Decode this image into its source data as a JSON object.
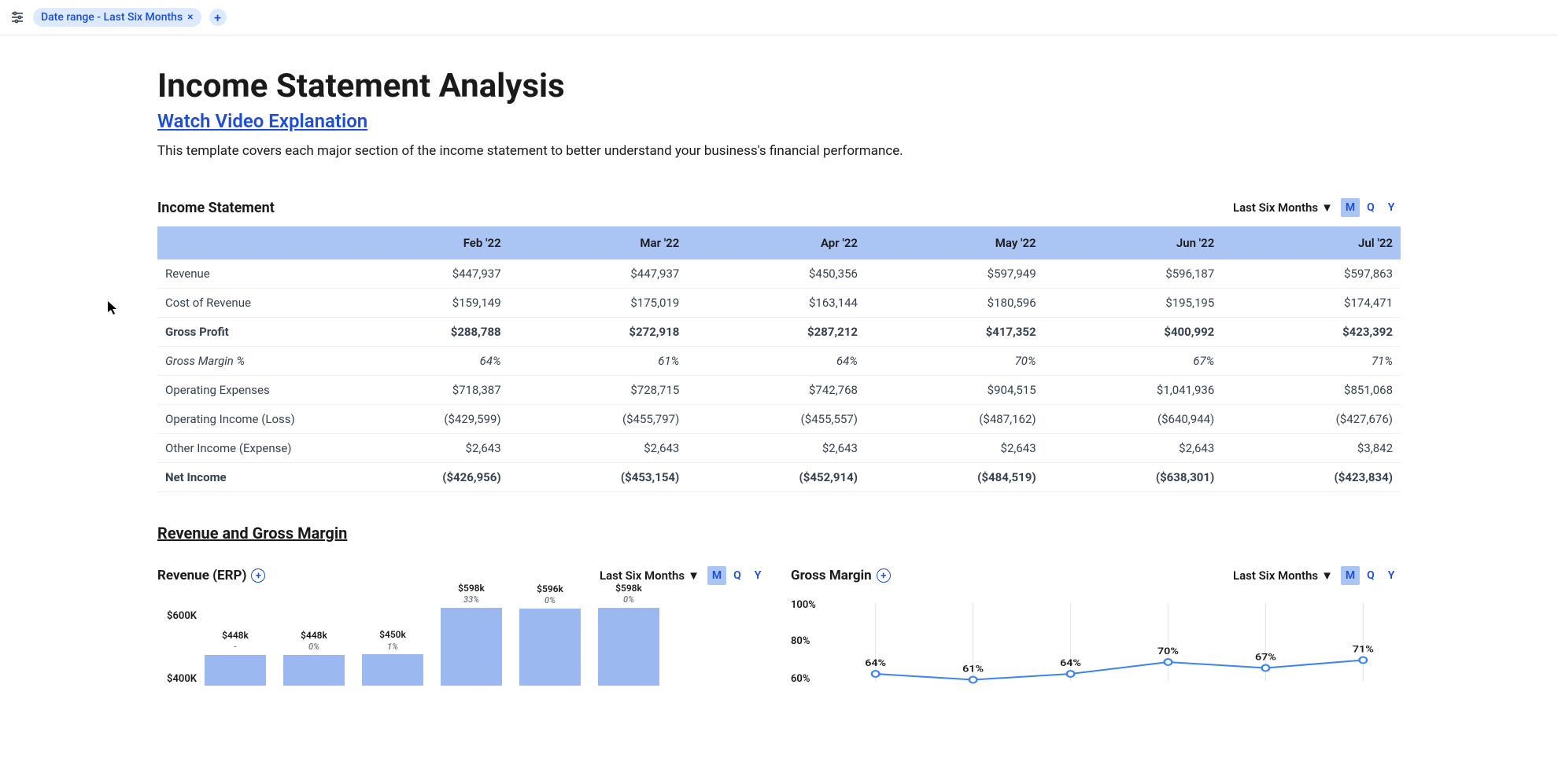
{
  "topbar": {
    "chip_label": "Date range - Last Six Months",
    "add_label": "+"
  },
  "header": {
    "title": "Income Statement Analysis",
    "video_link": "Watch Video Explanation",
    "description": "This template covers each major section of the income statement to better understand your business's financial performance."
  },
  "income_table": {
    "title": "Income Statement",
    "range_label": "Last Six Months",
    "periods": [
      "M",
      "Q",
      "Y"
    ],
    "active_period": "M",
    "columns": [
      "Feb '22",
      "Mar '22",
      "Apr '22",
      "May '22",
      "Jun '22",
      "Jul '22"
    ],
    "rows": [
      {
        "label": "Revenue",
        "values": [
          "$447,937",
          "$447,937",
          "$450,356",
          "$597,949",
          "$596,187",
          "$597,863"
        ],
        "style": "normal"
      },
      {
        "label": "Cost of Revenue",
        "values": [
          "$159,149",
          "$175,019",
          "$163,144",
          "$180,596",
          "$195,195",
          "$174,471"
        ],
        "style": "normal"
      },
      {
        "label": "Gross Profit",
        "values": [
          "$288,788",
          "$272,918",
          "$287,212",
          "$417,352",
          "$400,992",
          "$423,392"
        ],
        "style": "bold"
      },
      {
        "label": "Gross Margin %",
        "values": [
          "64%",
          "61%",
          "64%",
          "70%",
          "67%",
          "71%"
        ],
        "style": "italic"
      },
      {
        "label": "Operating Expenses",
        "values": [
          "$718,387",
          "$728,715",
          "$742,768",
          "$904,515",
          "$1,041,936",
          "$851,068"
        ],
        "style": "normal"
      },
      {
        "label": "Operating Income (Loss)",
        "values": [
          "($429,599)",
          "($455,797)",
          "($455,557)",
          "($487,162)",
          "($640,944)",
          "($427,676)"
        ],
        "style": "normal",
        "neg": true
      },
      {
        "label": "Other Income (Expense)",
        "values": [
          "$2,643",
          "$2,643",
          "$2,643",
          "$2,643",
          "$2,643",
          "$3,842"
        ],
        "style": "normal"
      },
      {
        "label": "Net Income",
        "values": [
          "($426,956)",
          "($453,154)",
          "($452,914)",
          "($484,519)",
          "($638,301)",
          "($423,834)"
        ],
        "style": "net",
        "neg": true
      }
    ]
  },
  "section2_title": "Revenue and Gross Margin",
  "revenue_chart": {
    "title": "Revenue (ERP)",
    "range_label": "Last Six Months",
    "periods": [
      "M",
      "Q",
      "Y"
    ],
    "y_ticks": [
      "$600K",
      "$400K"
    ]
  },
  "margin_chart": {
    "title": "Gross Margin",
    "range_label": "Last Six Months",
    "periods": [
      "M",
      "Q",
      "Y"
    ],
    "y_ticks": [
      "100%",
      "80%",
      "60%"
    ]
  },
  "chart_data": [
    {
      "type": "bar",
      "title": "Revenue (ERP)",
      "categories": [
        "Feb '22",
        "Mar '22",
        "Apr '22",
        "May '22",
        "Jun '22",
        "Jul '22"
      ],
      "values": [
        448000,
        448000,
        450000,
        598000,
        596000,
        598000
      ],
      "labels_top": [
        "$448k",
        "$448k",
        "$450k",
        "$598k",
        "$596k",
        "$598k"
      ],
      "labels_sub": [
        "-",
        "0%",
        "1%",
        "33%",
        "0%",
        "0%"
      ],
      "ylabel": "Revenue",
      "ylim": [
        400000,
        600000
      ]
    },
    {
      "type": "line",
      "title": "Gross Margin",
      "categories": [
        "Feb '22",
        "Mar '22",
        "Apr '22",
        "May '22",
        "Jun '22",
        "Jul '22"
      ],
      "values": [
        64,
        61,
        64,
        70,
        67,
        71
      ],
      "labels": [
        "64%",
        "61%",
        "64%",
        "70%",
        "67%",
        "71%"
      ],
      "ylabel": "Gross Margin %",
      "ylim": [
        60,
        100
      ]
    }
  ]
}
